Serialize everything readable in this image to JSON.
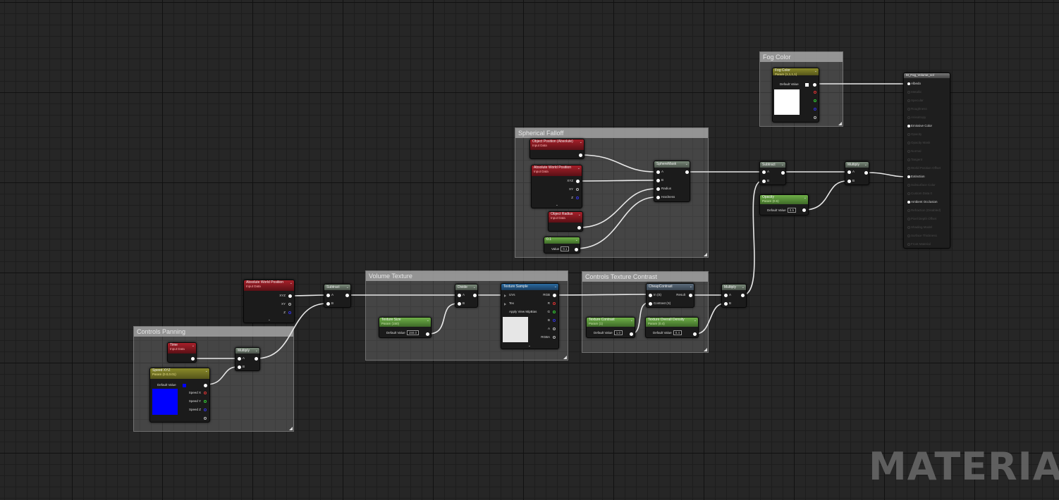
{
  "watermark": "MATERIAL",
  "colors": {
    "wire": "#e8e8e8",
    "speed_swatch": "#0000ff",
    "fog_swatch": "#ffffff"
  },
  "comments": {
    "fog_color": "Fog Color",
    "spherical_falloff": "Spherical Falloff",
    "volume_texture": "Volume Texture",
    "controls_texture_contrast": "Controls Texture Contrast",
    "controls_panning": "Controls Panning"
  },
  "nodes": {
    "fog_color": {
      "title": "Fog Color",
      "subtitle": "Param (1,1,1,1)",
      "default_label": "Default Value"
    },
    "object_position": {
      "title": "Object Position (Absolute)",
      "subtitle": "Input Data"
    },
    "abs_world_pos_1": {
      "title": "Absolute World Position",
      "subtitle": "Input Data",
      "pins": [
        "XYZ",
        "XY",
        "Z"
      ]
    },
    "object_radius": {
      "title": "Object Radius",
      "subtitle": "Input Data"
    },
    "const_01": {
      "title": "0.1",
      "value_label": "Value",
      "value": "0.1"
    },
    "sphere_mask": {
      "title": "SphereMask",
      "pins": [
        "A",
        "B",
        "Radius",
        "Hardness"
      ]
    },
    "subtract_top": {
      "title": "Subtract",
      "pins": [
        "A",
        "B"
      ]
    },
    "opacity": {
      "title": "Opacity",
      "subtitle": "Param (0.5)",
      "default_label": "Default Value",
      "value": "0.5"
    },
    "multiply_top": {
      "title": "Multiply",
      "pins": [
        "A",
        "B"
      ]
    },
    "output": {
      "title": "M_Fog_Volume_vol",
      "pins": [
        {
          "label": "Albedo",
          "active": true
        },
        {
          "label": "Metallic",
          "active": false
        },
        {
          "label": "Specular",
          "active": false
        },
        {
          "label": "Roughness",
          "active": false
        },
        {
          "label": "Anisotropy",
          "active": false
        },
        {
          "label": "Emissive Color",
          "active": true
        },
        {
          "label": "Opacity",
          "active": false
        },
        {
          "label": "Opacity Mask",
          "active": false
        },
        {
          "label": "Normal",
          "active": false
        },
        {
          "label": "Tangent",
          "active": false
        },
        {
          "label": "World Position Offset",
          "active": false
        },
        {
          "label": "Extinction",
          "active": true
        },
        {
          "label": "Subsurface Color",
          "active": false
        },
        {
          "label": "Custom Data 0",
          "active": false
        },
        {
          "label": "Ambient Occlusion",
          "active": true
        },
        {
          "label": "Refraction (Disabled)",
          "active": false
        },
        {
          "label": "Pixel Depth Offset",
          "active": false
        },
        {
          "label": "Shading Model",
          "active": false
        },
        {
          "label": "Surface Thickness",
          "active": false
        },
        {
          "label": "Front Material",
          "active": false
        }
      ]
    },
    "abs_world_pos_2": {
      "title": "Absolute World Position",
      "subtitle": "Input Data",
      "pins": [
        "XYZ",
        "XY",
        "Z"
      ]
    },
    "subtract_mid": {
      "title": "Subtract",
      "pins": [
        "A",
        "B"
      ]
    },
    "divide": {
      "title": "Divide",
      "pins": [
        "A",
        "B"
      ]
    },
    "texture_size": {
      "title": "Texture Size",
      "subtitle": "Param (150)",
      "default_label": "Default Value",
      "value": "150.0"
    },
    "texture_sample": {
      "title": "Texture Sample",
      "pins": [
        "UVs",
        "Tex",
        "Apply View MipBias"
      ],
      "outputs": [
        "RGB",
        "R",
        "G",
        "B",
        "A",
        "RGBA"
      ]
    },
    "cheap_contrast": {
      "title": "CheapContrast",
      "pins": [
        "In (S)",
        "Contrast (S)"
      ],
      "output": "Result"
    },
    "texture_contrast": {
      "title": "Texture Contrast",
      "subtitle": "Param (1)",
      "default_label": "Default Value",
      "value": "1.0"
    },
    "texture_overall_density": {
      "title": "Texture Overall Density",
      "subtitle": "Param (0.4)",
      "default_label": "Default Value",
      "value": "0.4"
    },
    "multiply_mid": {
      "title": "Multiply",
      "pins": [
        "A",
        "B"
      ]
    },
    "time": {
      "title": "Time",
      "subtitle": "Input Data"
    },
    "multiply_low": {
      "title": "Multiply",
      "pins": [
        "A",
        "B"
      ]
    },
    "speed_xyz": {
      "title": "Speed XYZ",
      "subtitle": "Param (0.0,0.01)",
      "default_label": "Default Value",
      "pins": [
        "Speed X",
        "Speed Y",
        "Speed Z"
      ]
    }
  }
}
